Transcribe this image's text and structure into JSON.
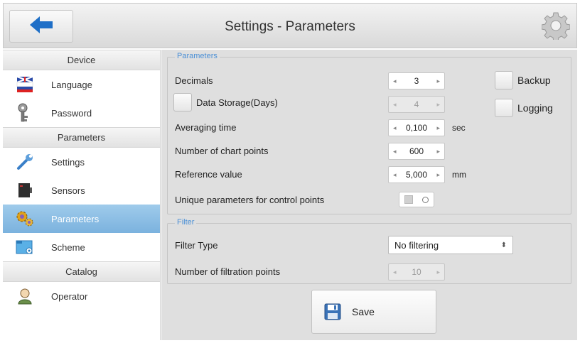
{
  "header": {
    "title": "Settings - Parameters",
    "back_icon": "arrow-left-icon",
    "settings_icon": "gear-icon"
  },
  "sidebar": {
    "sections": [
      {
        "label": "Device",
        "items": [
          {
            "label": "Language",
            "icon": "flag-icon"
          },
          {
            "label": "Password",
            "icon": "key-icon"
          }
        ]
      },
      {
        "label": "Parameters",
        "items": [
          {
            "label": "Settings",
            "icon": "wrench-icon"
          },
          {
            "label": "Sensors",
            "icon": "sensor-device-icon"
          },
          {
            "label": "Parameters",
            "icon": "gears-icon",
            "active": true
          },
          {
            "label": "Scheme",
            "icon": "scheme-icon"
          }
        ]
      },
      {
        "label": "Catalog",
        "items": [
          {
            "label": "Operator",
            "icon": "user-icon"
          }
        ]
      }
    ]
  },
  "parameters": {
    "legend": "Parameters",
    "decimals": {
      "label": "Decimals",
      "value": "3"
    },
    "data_storage": {
      "label": "Data Storage(Days)",
      "value": "4",
      "checked": false
    },
    "averaging_time": {
      "label": "Averaging time",
      "value": "0,100",
      "unit": "sec"
    },
    "chart_points": {
      "label": "Number of chart points",
      "value": "600"
    },
    "reference_value": {
      "label": "Reference value",
      "value": "5,000",
      "unit": "mm"
    },
    "unique_params": {
      "label": "Unique parameters for control points",
      "on": false
    },
    "backup": {
      "label": "Backup",
      "checked": false
    },
    "logging": {
      "label": "Logging",
      "checked": false
    }
  },
  "filter": {
    "legend": "Filter",
    "filter_type": {
      "label": "Filter Type",
      "value": "No filtering"
    },
    "filtration_points": {
      "label": "Number of filtration points",
      "value": "10"
    }
  },
  "save": {
    "label": "Save",
    "icon": "floppy-disk-icon"
  },
  "colors": {
    "accent": "#1f6fc7",
    "active_item": "#8ec0e6",
    "panel_bg": "#dfdfdf",
    "legend": "#4a8fd6"
  }
}
